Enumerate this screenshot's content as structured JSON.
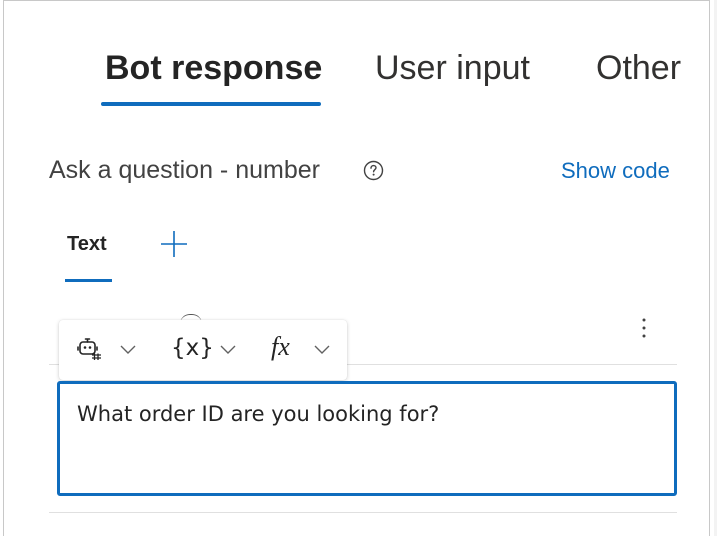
{
  "tabs": [
    {
      "label": "Bot response",
      "active": true
    },
    {
      "label": "User input",
      "active": false
    },
    {
      "label": "Other",
      "active": false
    }
  ],
  "node": {
    "title": "Ask a question - number",
    "help_icon": "question-circle-icon",
    "show_code_label": "Show code"
  },
  "subtabs": {
    "text_label": "Text",
    "add_icon": "plus-icon"
  },
  "toolbar": {
    "robot_icon": "bot-card-icon",
    "variable_label": "{x}",
    "formula_label": "fx",
    "chevron_icon": "chevron-down-icon"
  },
  "message": {
    "text": "What order ID are you looking for?"
  },
  "menu": {
    "more_icon": "more-vertical-icon"
  },
  "colors": {
    "accent": "#0f6cbd",
    "text": "#242424",
    "divider": "#e0e0e0"
  }
}
